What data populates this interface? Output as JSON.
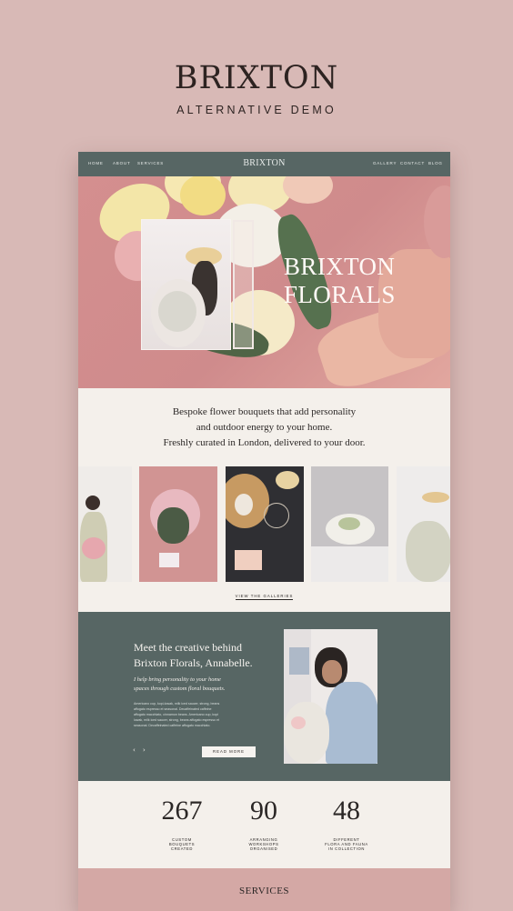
{
  "brand": {
    "title": "BRIXTON",
    "subtitle": "ALTERNATIVE DEMO"
  },
  "nav": {
    "left_items": [
      "HOME",
      "ABOUT",
      "SERVICES"
    ],
    "logo": "BRIXTON",
    "right_items": [
      "GALLERY",
      "CONTACT",
      "BLOG"
    ],
    "background": "#576664"
  },
  "hero": {
    "title_line1": "BRIXTON",
    "title_line2": "FLORALS",
    "background": "#cf8b8c"
  },
  "tagline": {
    "line1": "Bespoke flower bouquets that add personality",
    "line2": "and outdoor energy to your home.",
    "line3": "Freshly curated in London, delivered to your door."
  },
  "gallery": {
    "link_label": "VIEW THE GALLERIES"
  },
  "about": {
    "heading_line1": "Meet the creative behind",
    "heading_line2": "Brixton Florals, Annabelle.",
    "quote_line1": "I help bring personality to your home",
    "quote_line2": "spaces through custom floral bouquets.",
    "body_lines": [
      "Americano cup, kopi-luwak, milk iced saucer, strong, beans",
      "affogato espresso et seasonal. Decaffeinated caffeine",
      "affogato macchiato, cinnamon beans. Americano cup, kopi",
      "luwak, milk iced saucer, strong, beans affogato espresso et",
      "seasonal. Decaffeinated caffeine affogato macchiato."
    ],
    "prev_arrow": "‹",
    "next_arrow": "›",
    "button_label": "READ MORE",
    "background": "#576664"
  },
  "stats": [
    {
      "value": "267",
      "label_lines": [
        "CUSTOM",
        "BOUQUETS",
        "CREATED"
      ]
    },
    {
      "value": "90",
      "label_lines": [
        "ARRANGING",
        "WORKSHOPS",
        "ORGANISED"
      ]
    },
    {
      "value": "48",
      "label_lines": [
        "DIFFERENT",
        "FLORA AND FAUNA",
        "IN COLLECTION"
      ]
    }
  ],
  "services": {
    "title": "SERVICES",
    "background": "#d4a8a5"
  }
}
